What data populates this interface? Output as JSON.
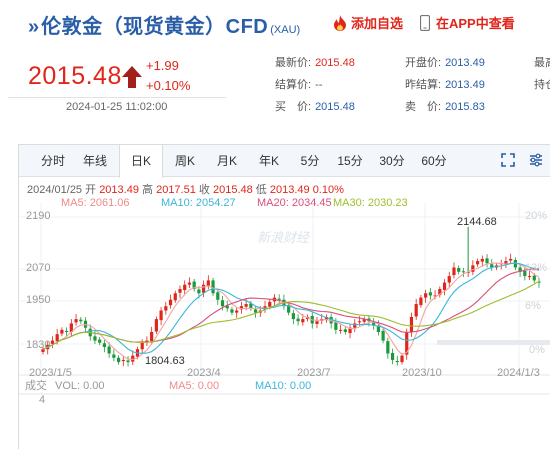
{
  "header": {
    "title": "伦敦金（现货黄金）CFD",
    "code": "(XAU)",
    "fav_label": "添加自选",
    "app_label": "在APP中查看"
  },
  "price": {
    "last": "2015.48",
    "change": "+1.99",
    "change_pct": "+0.10%",
    "timestamp": "2024-01-25 11:02:00"
  },
  "quote": {
    "col1": [
      {
        "label": "最新价:",
        "value": "2015.48"
      },
      {
        "label": "结算价:",
        "value": "--"
      },
      {
        "label": "买　价:",
        "value": "2015.48"
      }
    ],
    "col2": [
      {
        "label": "开盘价:",
        "value": "2013.49"
      },
      {
        "label": "昨结算:",
        "value": "2013.49"
      },
      {
        "label": "卖　价:",
        "value": "2015.83"
      }
    ],
    "col3": [
      {
        "label": "最高"
      },
      {
        "label": "持仓"
      }
    ]
  },
  "tabs": [
    "分时",
    "年线",
    "日K",
    "周K",
    "月K",
    "年K",
    "5分",
    "15分",
    "30分",
    "60分"
  ],
  "active_tab": 2,
  "info": {
    "date": "2024/01/25",
    "open_label": "开",
    "open": "2013.49",
    "high_label": "高",
    "high": "2017.51",
    "close_label": "收",
    "close": "2015.48",
    "low_label": "低",
    "low": "2013.49",
    "pct": "0.10%",
    "ma5": "MA5: 2061.06",
    "ma10": "MA10: 2054.27",
    "ma20": "MA20: 2034.45",
    "ma30": "MA30: 2030.23"
  },
  "chart_data": {
    "type": "candlestick",
    "y_ticks": [
      "2190",
      "2070",
      "1950",
      "1830"
    ],
    "y_ticks_right": [
      "20%",
      "13%",
      "6%",
      "0%"
    ],
    "x_ticks": [
      "2023/1/5",
      "2023/4",
      "2023/7",
      "2023/10",
      "2024/1/3"
    ],
    "annotations": {
      "high": "2144.68",
      "low": "1804.63"
    },
    "watermark": "新浪财经",
    "ylim": [
      1800,
      2200
    ],
    "closes": [
      1860,
      1870,
      1880,
      1895,
      1905,
      1900,
      1920,
      1930,
      1925,
      1910,
      1890,
      1880,
      1875,
      1865,
      1850,
      1840,
      1830,
      1835,
      1830,
      1845,
      1860,
      1875,
      1880,
      1900,
      1930,
      1950,
      1960,
      1975,
      1990,
      2000,
      2010,
      2015,
      2000,
      1990,
      2010,
      2020,
      1990,
      1975,
      1960,
      1955,
      1945,
      1950,
      1960,
      1965,
      1955,
      1945,
      1950,
      1960,
      1970,
      1980,
      1975,
      1960,
      1945,
      1930,
      1925,
      1930,
      1935,
      1920,
      1925,
      1930,
      1935,
      1920,
      1905,
      1905,
      1900,
      1910,
      1920,
      1925,
      1930,
      1925,
      1915,
      1900,
      1880,
      1850,
      1835,
      1830,
      1845,
      1900,
      1935,
      1965,
      1980,
      1990,
      1985,
      1985,
      2000,
      2015,
      2030,
      2050,
      2040,
      2040,
      2040,
      2055,
      2065,
      2070,
      2060,
      2050,
      2055,
      2060,
      2065,
      2070,
      2050,
      2040,
      2030,
      2030,
      2020,
      2015
    ],
    "indicators": {
      "vol": "VOL: 0.00",
      "ma5": "MA5: 0.00",
      "ma10": "MA10: 0.00",
      "lot_label": "成交",
      "lot_value": "4"
    }
  },
  "colors": {
    "up": "#e0261b",
    "down": "#1a9a3a",
    "ma5": "#f5a2a2",
    "ma10": "#3bb7d8",
    "ma20": "#d94f7a",
    "ma30": "#9cbf2c",
    "accent": "#2a5ea7"
  }
}
